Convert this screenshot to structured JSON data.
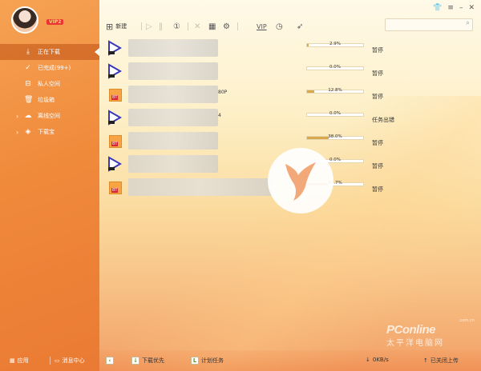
{
  "user": {
    "name": "",
    "vip_badge": "VIP2"
  },
  "sidebar": {
    "items": [
      {
        "label": "正在下载",
        "icon": "download-icon",
        "active": true
      },
      {
        "label": "已完成(99+)",
        "icon": "check-circle-icon"
      },
      {
        "label": "私人空间",
        "icon": "lock-icon"
      },
      {
        "label": "垃圾箱",
        "icon": "trash-icon"
      },
      {
        "label": "离线空间",
        "icon": "cloud-icon"
      },
      {
        "label": "下载宝",
        "icon": "router-icon"
      }
    ],
    "footer": {
      "apps_label": "应用",
      "messages_label": "消息中心"
    }
  },
  "toolbar": {
    "new_label": "新建",
    "vip_label": "VIP"
  },
  "window_controls": [
    "shirt-icon",
    "menu-icon",
    "minimize-icon",
    "close-icon"
  ],
  "search": {
    "placeholder": ""
  },
  "downloads": [
    {
      "type": "video",
      "name_suffix": "",
      "progress_text": "2.9%",
      "progress": 0.029,
      "status": "暂停"
    },
    {
      "type": "video",
      "name_suffix": "",
      "progress_text": "0.0%",
      "progress": 0.0,
      "status": "暂停"
    },
    {
      "type": "bt",
      "name_suffix": "80P",
      "progress_text": "12.8%",
      "progress": 0.128,
      "status": "暂停"
    },
    {
      "type": "video",
      "name_suffix": "4",
      "progress_text": "0.0%",
      "progress": 0.0,
      "status": "任务出错"
    },
    {
      "type": "bt",
      "name_suffix": "",
      "progress_text": "38.0%",
      "progress": 0.38,
      "status": "暂停"
    },
    {
      "type": "video",
      "name_suffix": "",
      "progress_text": "0.0%",
      "progress": 0.0,
      "status": "暂停"
    },
    {
      "type": "bt",
      "name_suffix": "",
      "progress_text": "37.7%",
      "progress": 0.377,
      "status": "暂停"
    }
  ],
  "bottombar": {
    "priority_label": "下载优先",
    "schedule_label": "计划任务",
    "speed": "0KB/s",
    "upload_label": "已关闭上传"
  },
  "watermark": {
    "brand": "PConline",
    "cn": "太平洋电脑网",
    "domain": ".com.cn"
  },
  "colors": {
    "sidebar": "#f08a3b",
    "accent": "#d8a84a",
    "active_item": "#c0561c"
  }
}
